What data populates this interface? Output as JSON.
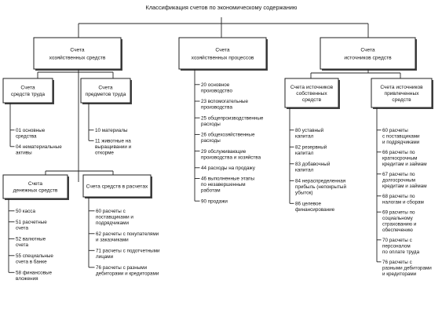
{
  "title": "Классификация счетов по экономическому содержанию",
  "top": [
    {
      "lines": [
        "Счета",
        "хозяйственных средств"
      ]
    },
    {
      "lines": [
        "Счета",
        "хозяйственных процессов"
      ]
    },
    {
      "lines": [
        "Счета",
        "источников средств"
      ]
    }
  ],
  "sub": {
    "trud": [
      "Счета",
      "средств труда"
    ],
    "predm": [
      "Счета",
      "предметов труда"
    ],
    "den": [
      "Счета",
      "денежных средств"
    ],
    "rasch": [
      "Счета средств в расчетах"
    ],
    "sobst": [
      "Счета источников",
      "собственных",
      "средств"
    ],
    "priv": [
      "Счета источников",
      "привлеченных",
      "средств"
    ]
  },
  "lists": {
    "trud": [
      [
        "01 основные",
        "средства"
      ],
      [
        "04 нематериальные",
        "активы"
      ]
    ],
    "predm": [
      [
        "10 материалы"
      ],
      [
        "11 животные на",
        "выращивании и",
        "откорме"
      ]
    ],
    "den": [
      [
        "50 касса"
      ],
      [
        "51 расчетные",
        "счета"
      ],
      [
        "52 валютные",
        "счета"
      ],
      [
        "55 специальные",
        "счета в банке"
      ],
      [
        "58 финансовые",
        "вложения"
      ]
    ],
    "rasch": [
      [
        "60 расчеты с",
        "поставщиками и",
        "подрядчиками"
      ],
      [
        "62 расчеты с покупателями",
        "и заказчиками"
      ],
      [
        "71 расчеты с подотчетными",
        "лицами"
      ],
      [
        "76 расчеты с разными",
        "дебиторами и кредиторами"
      ]
    ],
    "proc": [
      [
        "20 основное",
        "производство"
      ],
      [
        "23 вспомогательные",
        "производства"
      ],
      [
        "25 общепроизводственные",
        "расходы"
      ],
      [
        "26 общехозяйственные",
        "расходы"
      ],
      [
        "29 обслуживающие",
        "производства и хозяйства"
      ],
      [
        "44 расходы на продажу"
      ],
      [
        "46 выполненные этапы",
        "по незавершенным",
        "работам"
      ],
      [
        "90 продажи"
      ]
    ],
    "sobst": [
      [
        "80 уставный",
        "капитал"
      ],
      [
        "82 резервный",
        "капитал"
      ],
      [
        "83 добавочный",
        "капитал"
      ],
      [
        "84 нераспределенная",
        "прибыль (непокрытый",
        "убыток)"
      ],
      [
        "86 целевое",
        "финансирование"
      ]
    ],
    "priv": [
      [
        "60 расчеты",
        "с поставщиками",
        "и подрядчиками"
      ],
      [
        "66 расчеты по",
        "краткосрочным",
        "кредитам и займам"
      ],
      [
        "67 расчеты по",
        "долгосрочным",
        "кредитам и займам"
      ],
      [
        "68 расчеты по",
        "налогам и сборам"
      ],
      [
        "69 расчеты по",
        "социальному",
        "страхованию и",
        "обеспечению"
      ],
      [
        "70 расчеты с",
        "персоналом",
        "по оплате труда"
      ],
      [
        "76 расчеты с",
        "разными дебиторами",
        "и кредиторами"
      ]
    ]
  }
}
